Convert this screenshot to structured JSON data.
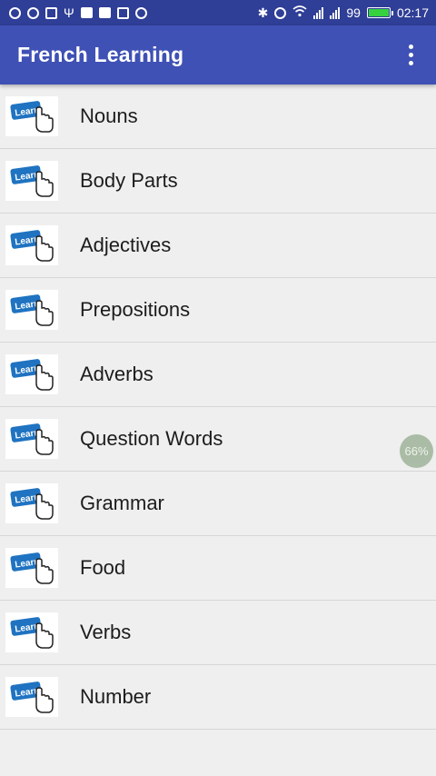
{
  "status_bar": {
    "battery_percent": "99",
    "battery_level": 0.99,
    "battery_color": "#36d13f",
    "time": "02:17",
    "left_icons": [
      "notification-icon",
      "weibo-icon",
      "image-icon",
      "usb-icon",
      "grid-app-icon",
      "keyboard-icon",
      "lastpass-icon",
      "clock-icon"
    ],
    "right_icons": [
      "bluetooth-icon",
      "alarm-icon",
      "wifi-icon",
      "signal-icon",
      "signal-icon",
      "battery-icon"
    ]
  },
  "app_bar": {
    "title": "French Learning",
    "background": "#3f51b5",
    "overflow_icon": "more-vert-icon"
  },
  "list": {
    "thumbnail_text": "Learn",
    "items": [
      {
        "label": "Nouns"
      },
      {
        "label": "Body Parts"
      },
      {
        "label": "Adjectives"
      },
      {
        "label": "Prepositions"
      },
      {
        "label": "Adverbs"
      },
      {
        "label": "Question Words"
      },
      {
        "label": "Grammar"
      },
      {
        "label": "Food"
      },
      {
        "label": "Verbs"
      },
      {
        "label": "Number"
      }
    ]
  },
  "floating_badge": {
    "text": "66%"
  }
}
